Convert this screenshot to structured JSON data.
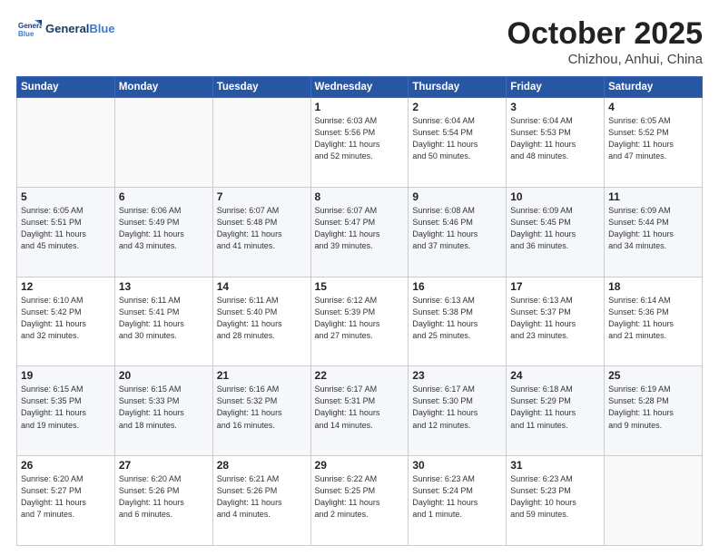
{
  "header": {
    "logo_line1": "General",
    "logo_line2": "Blue",
    "month": "October 2025",
    "location": "Chizhou, Anhui, China"
  },
  "weekdays": [
    "Sunday",
    "Monday",
    "Tuesday",
    "Wednesday",
    "Thursday",
    "Friday",
    "Saturday"
  ],
  "weeks": [
    [
      {
        "day": "",
        "info": ""
      },
      {
        "day": "",
        "info": ""
      },
      {
        "day": "",
        "info": ""
      },
      {
        "day": "1",
        "info": "Sunrise: 6:03 AM\nSunset: 5:56 PM\nDaylight: 11 hours\nand 52 minutes."
      },
      {
        "day": "2",
        "info": "Sunrise: 6:04 AM\nSunset: 5:54 PM\nDaylight: 11 hours\nand 50 minutes."
      },
      {
        "day": "3",
        "info": "Sunrise: 6:04 AM\nSunset: 5:53 PM\nDaylight: 11 hours\nand 48 minutes."
      },
      {
        "day": "4",
        "info": "Sunrise: 6:05 AM\nSunset: 5:52 PM\nDaylight: 11 hours\nand 47 minutes."
      }
    ],
    [
      {
        "day": "5",
        "info": "Sunrise: 6:05 AM\nSunset: 5:51 PM\nDaylight: 11 hours\nand 45 minutes."
      },
      {
        "day": "6",
        "info": "Sunrise: 6:06 AM\nSunset: 5:49 PM\nDaylight: 11 hours\nand 43 minutes."
      },
      {
        "day": "7",
        "info": "Sunrise: 6:07 AM\nSunset: 5:48 PM\nDaylight: 11 hours\nand 41 minutes."
      },
      {
        "day": "8",
        "info": "Sunrise: 6:07 AM\nSunset: 5:47 PM\nDaylight: 11 hours\nand 39 minutes."
      },
      {
        "day": "9",
        "info": "Sunrise: 6:08 AM\nSunset: 5:46 PM\nDaylight: 11 hours\nand 37 minutes."
      },
      {
        "day": "10",
        "info": "Sunrise: 6:09 AM\nSunset: 5:45 PM\nDaylight: 11 hours\nand 36 minutes."
      },
      {
        "day": "11",
        "info": "Sunrise: 6:09 AM\nSunset: 5:44 PM\nDaylight: 11 hours\nand 34 minutes."
      }
    ],
    [
      {
        "day": "12",
        "info": "Sunrise: 6:10 AM\nSunset: 5:42 PM\nDaylight: 11 hours\nand 32 minutes."
      },
      {
        "day": "13",
        "info": "Sunrise: 6:11 AM\nSunset: 5:41 PM\nDaylight: 11 hours\nand 30 minutes."
      },
      {
        "day": "14",
        "info": "Sunrise: 6:11 AM\nSunset: 5:40 PM\nDaylight: 11 hours\nand 28 minutes."
      },
      {
        "day": "15",
        "info": "Sunrise: 6:12 AM\nSunset: 5:39 PM\nDaylight: 11 hours\nand 27 minutes."
      },
      {
        "day": "16",
        "info": "Sunrise: 6:13 AM\nSunset: 5:38 PM\nDaylight: 11 hours\nand 25 minutes."
      },
      {
        "day": "17",
        "info": "Sunrise: 6:13 AM\nSunset: 5:37 PM\nDaylight: 11 hours\nand 23 minutes."
      },
      {
        "day": "18",
        "info": "Sunrise: 6:14 AM\nSunset: 5:36 PM\nDaylight: 11 hours\nand 21 minutes."
      }
    ],
    [
      {
        "day": "19",
        "info": "Sunrise: 6:15 AM\nSunset: 5:35 PM\nDaylight: 11 hours\nand 19 minutes."
      },
      {
        "day": "20",
        "info": "Sunrise: 6:15 AM\nSunset: 5:33 PM\nDaylight: 11 hours\nand 18 minutes."
      },
      {
        "day": "21",
        "info": "Sunrise: 6:16 AM\nSunset: 5:32 PM\nDaylight: 11 hours\nand 16 minutes."
      },
      {
        "day": "22",
        "info": "Sunrise: 6:17 AM\nSunset: 5:31 PM\nDaylight: 11 hours\nand 14 minutes."
      },
      {
        "day": "23",
        "info": "Sunrise: 6:17 AM\nSunset: 5:30 PM\nDaylight: 11 hours\nand 12 minutes."
      },
      {
        "day": "24",
        "info": "Sunrise: 6:18 AM\nSunset: 5:29 PM\nDaylight: 11 hours\nand 11 minutes."
      },
      {
        "day": "25",
        "info": "Sunrise: 6:19 AM\nSunset: 5:28 PM\nDaylight: 11 hours\nand 9 minutes."
      }
    ],
    [
      {
        "day": "26",
        "info": "Sunrise: 6:20 AM\nSunset: 5:27 PM\nDaylight: 11 hours\nand 7 minutes."
      },
      {
        "day": "27",
        "info": "Sunrise: 6:20 AM\nSunset: 5:26 PM\nDaylight: 11 hours\nand 6 minutes."
      },
      {
        "day": "28",
        "info": "Sunrise: 6:21 AM\nSunset: 5:26 PM\nDaylight: 11 hours\nand 4 minutes."
      },
      {
        "day": "29",
        "info": "Sunrise: 6:22 AM\nSunset: 5:25 PM\nDaylight: 11 hours\nand 2 minutes."
      },
      {
        "day": "30",
        "info": "Sunrise: 6:23 AM\nSunset: 5:24 PM\nDaylight: 11 hours\nand 1 minute."
      },
      {
        "day": "31",
        "info": "Sunrise: 6:23 AM\nSunset: 5:23 PM\nDaylight: 10 hours\nand 59 minutes."
      },
      {
        "day": "",
        "info": ""
      }
    ]
  ]
}
